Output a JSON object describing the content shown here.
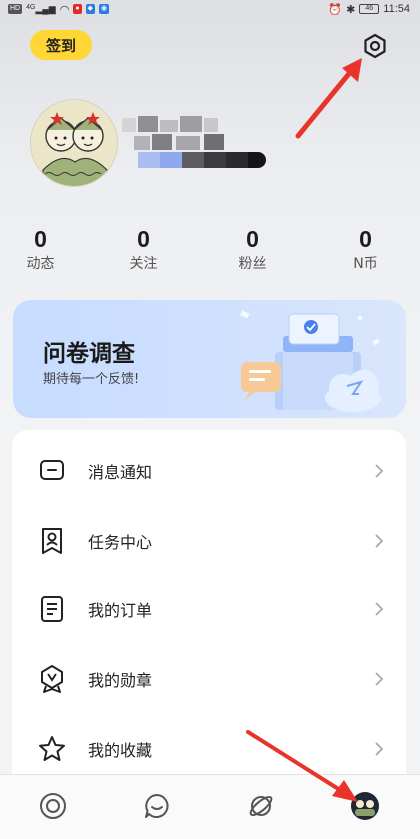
{
  "status_bar": {
    "network_left": "HD",
    "signal_text": "4G",
    "battery": "46",
    "time": "11:54"
  },
  "header": {
    "checkin_label": "签到",
    "settings_icon": "gear-icon"
  },
  "stats": [
    {
      "value": "0",
      "label": "动态"
    },
    {
      "value": "0",
      "label": "关注"
    },
    {
      "value": "0",
      "label": "粉丝"
    },
    {
      "value": "0",
      "label": "N币"
    }
  ],
  "survey": {
    "title": "问卷调查",
    "subtitle": "期待每一个反馈!"
  },
  "menu": [
    {
      "label": "消息通知",
      "icon": "message-icon"
    },
    {
      "label": "任务中心",
      "icon": "task-icon"
    },
    {
      "label": "我的订单",
      "icon": "order-icon"
    },
    {
      "label": "我的勋章",
      "icon": "medal-icon"
    },
    {
      "label": "我的收藏",
      "icon": "star-icon"
    }
  ],
  "bottom_nav": [
    {
      "icon": "home-ring-icon"
    },
    {
      "icon": "chat-icon"
    },
    {
      "icon": "planet-icon"
    },
    {
      "icon": "profile-avatar-icon"
    }
  ],
  "colors": {
    "accent_yellow": "#ffd633",
    "annotation_red": "#e8342a",
    "banner_blue": "#c7dcff"
  }
}
